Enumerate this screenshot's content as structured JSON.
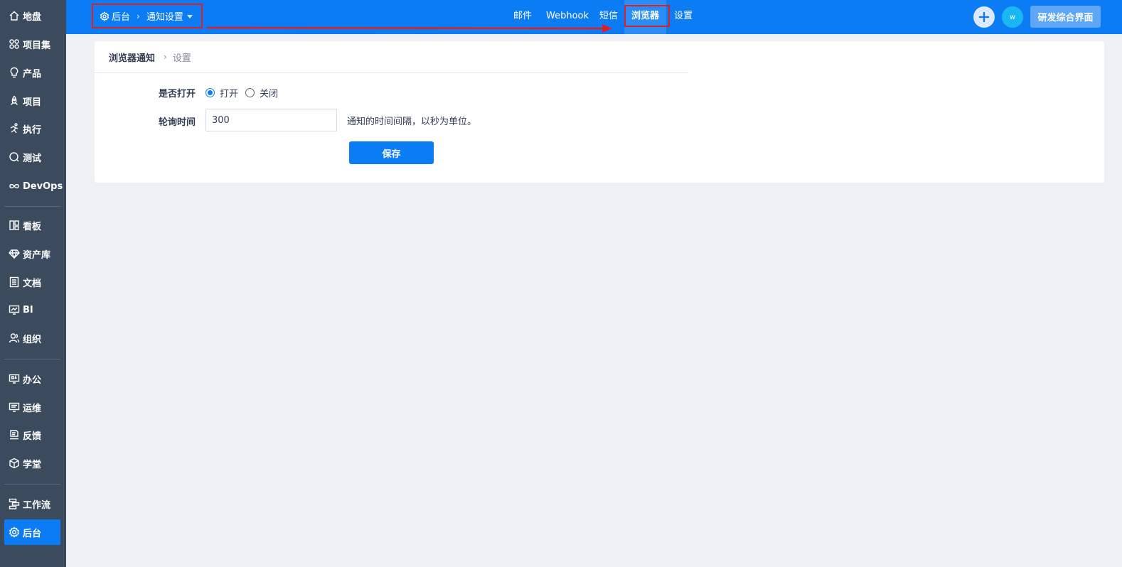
{
  "sidebar": {
    "items": [
      {
        "label": "地盘",
        "icon": "home-icon"
      },
      {
        "label": "项目集",
        "icon": "grid-icon"
      },
      {
        "label": "产品",
        "icon": "bulb-icon"
      },
      {
        "label": "项目",
        "icon": "rocket-icon"
      },
      {
        "label": "执行",
        "icon": "run-icon"
      },
      {
        "label": "测试",
        "icon": "test-search-icon"
      },
      {
        "label": "DevOps",
        "icon": "infinity-icon"
      },
      {
        "label": "看板",
        "icon": "kanban-icon"
      },
      {
        "label": "资产库",
        "icon": "diamond-icon"
      },
      {
        "label": "文档",
        "icon": "document-icon"
      },
      {
        "label": "BI",
        "icon": "monitor-chart-icon"
      },
      {
        "label": "组织",
        "icon": "people-icon"
      },
      {
        "label": "办公",
        "icon": "oa-icon"
      },
      {
        "label": "运维",
        "icon": "ops-icon"
      },
      {
        "label": "反馈",
        "icon": "feedback-icon"
      },
      {
        "label": "学堂",
        "icon": "cube-icon"
      },
      {
        "label": "工作流",
        "icon": "workflow-icon"
      },
      {
        "label": "后台",
        "icon": "gear-icon"
      }
    ],
    "active": "后台"
  },
  "topbar": {
    "breadcrumb": {
      "root": "后台",
      "current": "通知设置"
    },
    "nav": [
      "邮件",
      "Webhook",
      "短信",
      "浏览器",
      "设置"
    ],
    "active_nav": "浏览器",
    "avatar_text": "w",
    "switch_label": "研发综合界面"
  },
  "panel": {
    "title": "浏览器通知",
    "subtitle": "设置",
    "enable_label": "是否打开",
    "options": [
      "打开",
      "关闭"
    ],
    "selected_option": "打开",
    "interval_label": "轮询时间",
    "interval_value": "300",
    "interval_hint": "通知的时间间隔，以秒为单位。",
    "save_label": "保存"
  },
  "colors": {
    "primary": "#0c7cf5",
    "sidebar": "#3b4a5c",
    "highlight": "#e02020"
  }
}
